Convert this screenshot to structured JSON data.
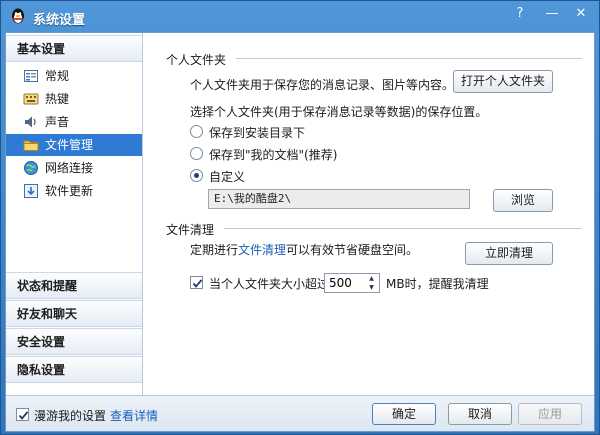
{
  "window": {
    "title": "系统设置",
    "help_glyph": "?",
    "minimize_glyph": "—",
    "close_glyph": "✕"
  },
  "sidebar": {
    "group_basic": "基本设置",
    "items": [
      {
        "label": "常规",
        "icon": "general-icon"
      },
      {
        "label": "热键",
        "icon": "hotkey-icon"
      },
      {
        "label": "声音",
        "icon": "sound-icon"
      },
      {
        "label": "文件管理",
        "icon": "folder-icon"
      },
      {
        "label": "网络连接",
        "icon": "network-icon"
      },
      {
        "label": "软件更新",
        "icon": "update-icon"
      }
    ],
    "active_index": 3,
    "groups_bottom": [
      "状态和提醒",
      "好友和聊天",
      "安全设置",
      "隐私设置"
    ]
  },
  "personal_folder": {
    "title": "个人文件夹",
    "desc": "个人文件夹用于保存您的消息记录、图片等内容。",
    "open_button": "打开个人文件夹",
    "choose_text": "选择个人文件夹(用于保存消息记录等数据)的保存位置。",
    "options": [
      "保存到安装目录下",
      "保存到\"我的文档\"(推荐)",
      "自定义"
    ],
    "selected_option": 2,
    "custom_path": "E:\\我的酷盘2\\",
    "browse_button": "浏览"
  },
  "file_cleanup": {
    "title": "文件清理",
    "desc_prefix": "定期进行",
    "desc_link": "文件清理",
    "desc_suffix": "可以有效节省硬盘空间。",
    "clean_button": "立即清理",
    "threshold_checked": true,
    "threshold_prefix": "当个人文件夹大小超过",
    "threshold_value": "500",
    "threshold_suffix": "MB时，提醒我清理"
  },
  "footer": {
    "roaming_checked": true,
    "roaming_label": "漫游我的设置",
    "details_link": "查看详情",
    "ok_button": "确定",
    "cancel_button": "取消",
    "apply_button": "应用"
  },
  "colors": {
    "accent": "#2e7ad4",
    "link": "#1a5fb8",
    "titlebar": "#3a82c8"
  }
}
